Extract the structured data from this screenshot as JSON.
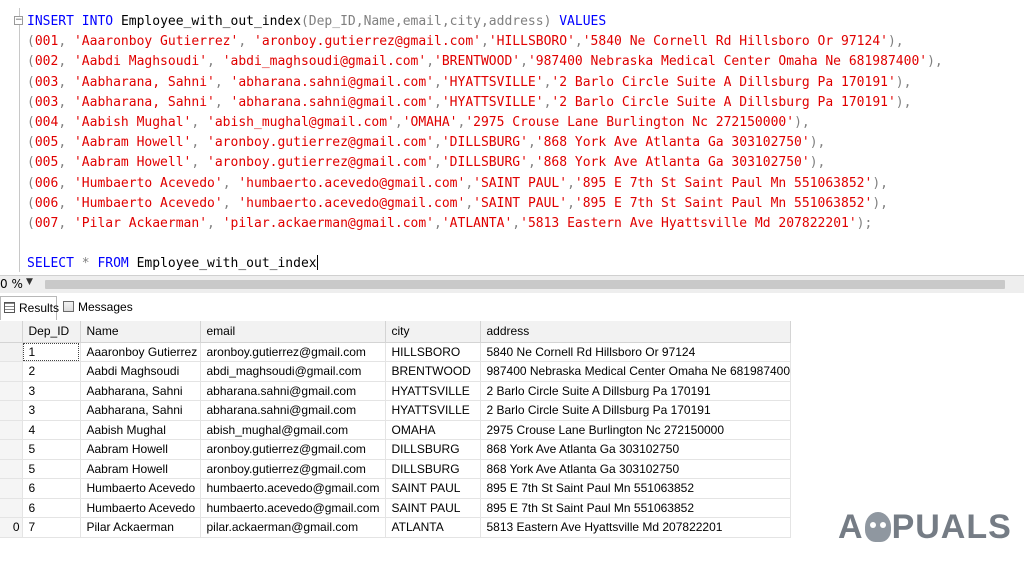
{
  "editor": {
    "insert_kw1": "INSERT",
    "insert_kw2": "INTO",
    "insert_table": "Employee_with_out_index",
    "insert_columns": "(Dep_ID,Name,email,city,address)",
    "insert_kw3": "VALUES",
    "value_rows": [
      {
        "prefix": "(",
        "id": "001",
        "sep1": ", ",
        "name": "'Aaaronboy Gutierrez'",
        "sep2": ", ",
        "email": "'aronboy.gutierrez@gmail.com'",
        "sep3": ",",
        "city": "'HILLSBORO'",
        "sep4": ",",
        "address": "'5840 Ne Cornell Rd Hillsboro Or 97124'",
        "suffix": "),"
      },
      {
        "prefix": "(",
        "id": "002",
        "sep1": ", ",
        "name": "'Aabdi Maghsoudi'",
        "sep2": ", ",
        "email": "'abdi_maghsoudi@gmail.com'",
        "sep3": ",",
        "city": "'BRENTWOOD'",
        "sep4": ",",
        "address": "'987400 Nebraska Medical Center Omaha Ne 681987400'",
        "suffix": "),"
      },
      {
        "prefix": "(",
        "id": "003",
        "sep1": ", ",
        "name": "'Aabharana, Sahni'",
        "sep2": ", ",
        "email": "'abharana.sahni@gmail.com'",
        "sep3": ",",
        "city": "'HYATTSVILLE'",
        "sep4": ",",
        "address": "'2 Barlo Circle Suite A Dillsburg Pa 170191'",
        "suffix": "),"
      },
      {
        "prefix": "(",
        "id": "003",
        "sep1": ", ",
        "name": "'Aabharana, Sahni'",
        "sep2": ", ",
        "email": "'abharana.sahni@gmail.com'",
        "sep3": ",",
        "city": "'HYATTSVILLE'",
        "sep4": ",",
        "address": "'2 Barlo Circle Suite A Dillsburg Pa 170191'",
        "suffix": "),"
      },
      {
        "prefix": "(",
        "id": "004",
        "sep1": ", ",
        "name": "'Aabish Mughal'",
        "sep2": ", ",
        "email": "'abish_mughal@gmail.com'",
        "sep3": ",",
        "city": "'OMAHA'",
        "sep4": ",",
        "address": "'2975 Crouse Lane Burlington Nc 272150000'",
        "suffix": "),"
      },
      {
        "prefix": "(",
        "id": "005",
        "sep1": ", ",
        "name": "'Aabram Howell'",
        "sep2": ", ",
        "email": "'aronboy.gutierrez@gmail.com'",
        "sep3": ",",
        "city": "'DILLSBURG'",
        "sep4": ",",
        "address": "'868 York Ave Atlanta Ga 303102750'",
        "suffix": "),"
      },
      {
        "prefix": "(",
        "id": "005",
        "sep1": ", ",
        "name": "'Aabram Howell'",
        "sep2": ", ",
        "email": "'aronboy.gutierrez@gmail.com'",
        "sep3": ",",
        "city": "'DILLSBURG'",
        "sep4": ",",
        "address": "'868 York Ave Atlanta Ga 303102750'",
        "suffix": "),"
      },
      {
        "prefix": "(",
        "id": "006",
        "sep1": ", ",
        "name": "'Humbaerto Acevedo'",
        "sep2": ", ",
        "email": "'humbaerto.acevedo@gmail.com'",
        "sep3": ",",
        "city": "'SAINT PAUL'",
        "sep4": ",",
        "address": "'895 E 7th St Saint Paul Mn 551063852'",
        "suffix": "),"
      },
      {
        "prefix": "(",
        "id": "006",
        "sep1": ", ",
        "name": "'Humbaerto Acevedo'",
        "sep2": ", ",
        "email": "'humbaerto.acevedo@gmail.com'",
        "sep3": ",",
        "city": "'SAINT PAUL'",
        "sep4": ",",
        "address": "'895 E 7th St Saint Paul Mn 551063852'",
        "suffix": "),"
      },
      {
        "prefix": "(",
        "id": "007",
        "sep1": ", ",
        "name": "'Pilar Ackaerman'",
        "sep2": ", ",
        "email": "'pilar.ackaerman@gmail.com'",
        "sep3": ",",
        "city": "'ATLANTA'",
        "sep4": ",",
        "address": "'5813 Eastern Ave Hyattsville Md 207822201'",
        "suffix": ");"
      }
    ],
    "select_kw": "SELECT",
    "select_star": "*",
    "from_kw": "FROM",
    "select_table": "Employee_with_out_index"
  },
  "zoom": {
    "label": "0 %"
  },
  "tabs": {
    "results": "Results",
    "messages": "Messages"
  },
  "grid": {
    "columns": [
      "Dep_ID",
      "Name",
      "email",
      "city",
      "address"
    ],
    "rows": [
      {
        "rownum": "",
        "dep_id": "1",
        "name": "Aaaronboy Gutierrez",
        "email": "aronboy.gutierrez@gmail.com",
        "city": "HILLSBORO",
        "address": "5840 Ne Cornell Rd Hillsboro Or 97124"
      },
      {
        "rownum": "",
        "dep_id": "2",
        "name": "Aabdi Maghsoudi",
        "email": "abdi_maghsoudi@gmail.com",
        "city": "BRENTWOOD",
        "address": "987400 Nebraska Medical Center Omaha Ne 681987400"
      },
      {
        "rownum": "",
        "dep_id": "3",
        "name": "Aabharana, Sahni",
        "email": "abharana.sahni@gmail.com",
        "city": "HYATTSVILLE",
        "address": "2 Barlo Circle Suite A Dillsburg Pa 170191"
      },
      {
        "rownum": "",
        "dep_id": "3",
        "name": "Aabharana, Sahni",
        "email": "abharana.sahni@gmail.com",
        "city": "HYATTSVILLE",
        "address": "2 Barlo Circle Suite A Dillsburg Pa 170191"
      },
      {
        "rownum": "",
        "dep_id": "4",
        "name": "Aabish Mughal",
        "email": "abish_mughal@gmail.com",
        "city": "OMAHA",
        "address": "2975 Crouse Lane Burlington Nc 272150000"
      },
      {
        "rownum": "",
        "dep_id": "5",
        "name": "Aabram Howell",
        "email": "aronboy.gutierrez@gmail.com",
        "city": "DILLSBURG",
        "address": "868 York Ave Atlanta Ga 303102750"
      },
      {
        "rownum": "",
        "dep_id": "5",
        "name": "Aabram Howell",
        "email": "aronboy.gutierrez@gmail.com",
        "city": "DILLSBURG",
        "address": "868 York Ave Atlanta Ga 303102750"
      },
      {
        "rownum": "",
        "dep_id": "6",
        "name": "Humbaerto Acevedo",
        "email": "humbaerto.acevedo@gmail.com",
        "city": "SAINT PAUL",
        "address": "895 E 7th St Saint Paul Mn 551063852"
      },
      {
        "rownum": "",
        "dep_id": "6",
        "name": "Humbaerto Acevedo",
        "email": "humbaerto.acevedo@gmail.com",
        "city": "SAINT PAUL",
        "address": "895 E 7th St Saint Paul Mn 551063852"
      },
      {
        "rownum": "0",
        "dep_id": "7",
        "name": "Pilar Ackaerman",
        "email": "pilar.ackaerman@gmail.com",
        "city": "ATLANTA",
        "address": "5813 Eastern Ave Hyattsville Md 207822201"
      }
    ]
  },
  "watermark": {
    "left": "A",
    "right": "PUALS"
  }
}
